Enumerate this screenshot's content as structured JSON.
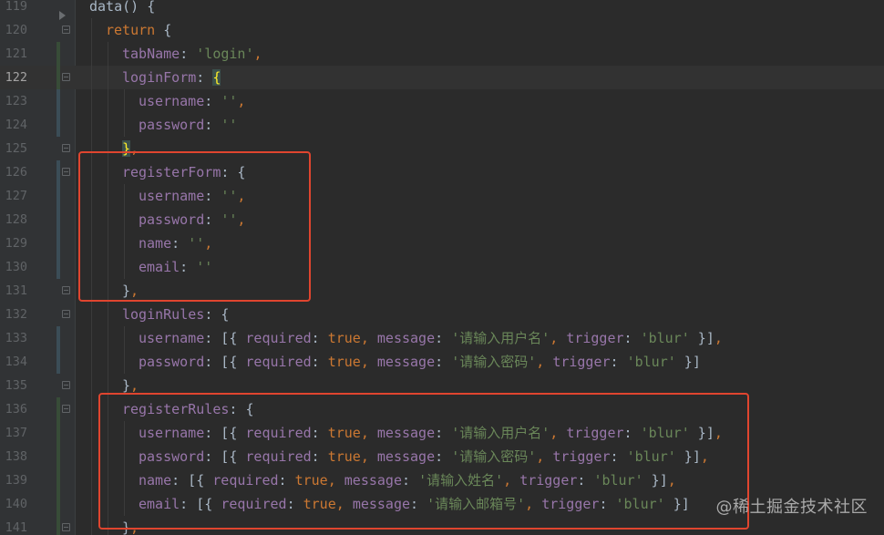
{
  "editor": {
    "first_line_number": 119,
    "current_line_number": 122,
    "accent_colors": {
      "keyword": "#cc7832",
      "property": "#9876aa",
      "string": "#6a8759",
      "highlight_box": "#e0452f"
    }
  },
  "lines": [
    {
      "n": "119",
      "indent": 0,
      "tokens": [
        [
          "pun",
          "data() {"
        ]
      ]
    },
    {
      "n": "120",
      "indent": 1,
      "tokens": [
        [
          "kw",
          "return"
        ],
        [
          "pun",
          " {"
        ]
      ]
    },
    {
      "n": "121",
      "indent": 2,
      "tokens": [
        [
          "prop",
          "tabName"
        ],
        [
          "pun",
          ": "
        ],
        [
          "str",
          "'login'"
        ],
        [
          "com",
          ","
        ]
      ]
    },
    {
      "n": "122",
      "indent": 2,
      "tokens": [
        [
          "prop",
          "loginForm"
        ],
        [
          "pun",
          ": "
        ],
        [
          "brace",
          "{"
        ]
      ]
    },
    {
      "n": "123",
      "indent": 3,
      "tokens": [
        [
          "prop",
          "username"
        ],
        [
          "pun",
          ": "
        ],
        [
          "str",
          "''"
        ],
        [
          "com",
          ","
        ]
      ]
    },
    {
      "n": "124",
      "indent": 3,
      "tokens": [
        [
          "prop",
          "password"
        ],
        [
          "pun",
          ": "
        ],
        [
          "str",
          "''"
        ]
      ]
    },
    {
      "n": "125",
      "indent": 2,
      "tokens": [
        [
          "brace",
          "}"
        ],
        [
          "com",
          ","
        ]
      ]
    },
    {
      "n": "126",
      "indent": 2,
      "tokens": [
        [
          "prop",
          "registerForm"
        ],
        [
          "pun",
          ": {"
        ]
      ]
    },
    {
      "n": "127",
      "indent": 3,
      "tokens": [
        [
          "prop",
          "username"
        ],
        [
          "pun",
          ": "
        ],
        [
          "str",
          "''"
        ],
        [
          "com",
          ","
        ]
      ]
    },
    {
      "n": "128",
      "indent": 3,
      "tokens": [
        [
          "prop",
          "password"
        ],
        [
          "pun",
          ": "
        ],
        [
          "str",
          "''"
        ],
        [
          "com",
          ","
        ]
      ]
    },
    {
      "n": "129",
      "indent": 3,
      "tokens": [
        [
          "prop",
          "name"
        ],
        [
          "pun",
          ": "
        ],
        [
          "str",
          "''"
        ],
        [
          "com",
          ","
        ]
      ]
    },
    {
      "n": "130",
      "indent": 3,
      "tokens": [
        [
          "prop",
          "email"
        ],
        [
          "pun",
          ": "
        ],
        [
          "str",
          "''"
        ]
      ]
    },
    {
      "n": "131",
      "indent": 2,
      "tokens": [
        [
          "pun",
          "}"
        ],
        [
          "com",
          ","
        ]
      ]
    },
    {
      "n": "132",
      "indent": 2,
      "tokens": [
        [
          "prop",
          "loginRules"
        ],
        [
          "pun",
          ": {"
        ]
      ]
    },
    {
      "n": "133",
      "indent": 3,
      "tokens": [
        [
          "prop",
          "username"
        ],
        [
          "pun",
          ": [{ "
        ],
        [
          "prop",
          "required"
        ],
        [
          "pun",
          ": "
        ],
        [
          "kw",
          "true"
        ],
        [
          "com",
          ", "
        ],
        [
          "prop",
          "message"
        ],
        [
          "pun",
          ": "
        ],
        [
          "str",
          "'请输入用户名'"
        ],
        [
          "com",
          ", "
        ],
        [
          "prop",
          "trigger"
        ],
        [
          "pun",
          ": "
        ],
        [
          "str",
          "'blur'"
        ],
        [
          "pun",
          " }]"
        ],
        [
          "com",
          ","
        ]
      ]
    },
    {
      "n": "134",
      "indent": 3,
      "tokens": [
        [
          "prop",
          "password"
        ],
        [
          "pun",
          ": [{ "
        ],
        [
          "prop",
          "required"
        ],
        [
          "pun",
          ": "
        ],
        [
          "kw",
          "true"
        ],
        [
          "com",
          ", "
        ],
        [
          "prop",
          "message"
        ],
        [
          "pun",
          ": "
        ],
        [
          "str",
          "'请输入密码'"
        ],
        [
          "com",
          ", "
        ],
        [
          "prop",
          "trigger"
        ],
        [
          "pun",
          ": "
        ],
        [
          "str",
          "'blur'"
        ],
        [
          "pun",
          " }]"
        ]
      ]
    },
    {
      "n": "135",
      "indent": 2,
      "tokens": [
        [
          "pun",
          "}"
        ],
        [
          "com",
          ","
        ]
      ]
    },
    {
      "n": "136",
      "indent": 2,
      "tokens": [
        [
          "prop",
          "registerRules"
        ],
        [
          "pun",
          ": {"
        ]
      ]
    },
    {
      "n": "137",
      "indent": 3,
      "tokens": [
        [
          "prop",
          "username"
        ],
        [
          "pun",
          ": [{ "
        ],
        [
          "prop",
          "required"
        ],
        [
          "pun",
          ": "
        ],
        [
          "kw",
          "true"
        ],
        [
          "com",
          ", "
        ],
        [
          "prop",
          "message"
        ],
        [
          "pun",
          ": "
        ],
        [
          "str",
          "'请输入用户名'"
        ],
        [
          "com",
          ", "
        ],
        [
          "prop",
          "trigger"
        ],
        [
          "pun",
          ": "
        ],
        [
          "str",
          "'blur'"
        ],
        [
          "pun",
          " }]"
        ],
        [
          "com",
          ","
        ]
      ]
    },
    {
      "n": "138",
      "indent": 3,
      "tokens": [
        [
          "prop",
          "password"
        ],
        [
          "pun",
          ": [{ "
        ],
        [
          "prop",
          "required"
        ],
        [
          "pun",
          ": "
        ],
        [
          "kw",
          "true"
        ],
        [
          "com",
          ", "
        ],
        [
          "prop",
          "message"
        ],
        [
          "pun",
          ": "
        ],
        [
          "str",
          "'请输入密码'"
        ],
        [
          "com",
          ", "
        ],
        [
          "prop",
          "trigger"
        ],
        [
          "pun",
          ": "
        ],
        [
          "str",
          "'blur'"
        ],
        [
          "pun",
          " }]"
        ],
        [
          "com",
          ","
        ]
      ]
    },
    {
      "n": "139",
      "indent": 3,
      "tokens": [
        [
          "prop",
          "name"
        ],
        [
          "pun",
          ": [{ "
        ],
        [
          "prop",
          "required"
        ],
        [
          "pun",
          ": "
        ],
        [
          "kw",
          "true"
        ],
        [
          "com",
          ", "
        ],
        [
          "prop",
          "message"
        ],
        [
          "pun",
          ": "
        ],
        [
          "str",
          "'请输入姓名'"
        ],
        [
          "com",
          ", "
        ],
        [
          "prop",
          "trigger"
        ],
        [
          "pun",
          ": "
        ],
        [
          "str",
          "'blur'"
        ],
        [
          "pun",
          " }]"
        ],
        [
          "com",
          ","
        ]
      ]
    },
    {
      "n": "140",
      "indent": 3,
      "tokens": [
        [
          "prop",
          "email"
        ],
        [
          "pun",
          ": [{ "
        ],
        [
          "prop",
          "required"
        ],
        [
          "pun",
          ": "
        ],
        [
          "kw",
          "true"
        ],
        [
          "com",
          ", "
        ],
        [
          "prop",
          "message"
        ],
        [
          "pun",
          ": "
        ],
        [
          "str",
          "'请输入邮箱号'"
        ],
        [
          "com",
          ", "
        ],
        [
          "prop",
          "trigger"
        ],
        [
          "pun",
          ": "
        ],
        [
          "str",
          "'blur'"
        ],
        [
          "pun",
          " }]"
        ]
      ]
    },
    {
      "n": "141",
      "indent": 2,
      "tokens": [
        [
          "pun",
          "}"
        ],
        [
          "com",
          ","
        ]
      ]
    }
  ],
  "watermark": "@稀土掘金技术社区"
}
